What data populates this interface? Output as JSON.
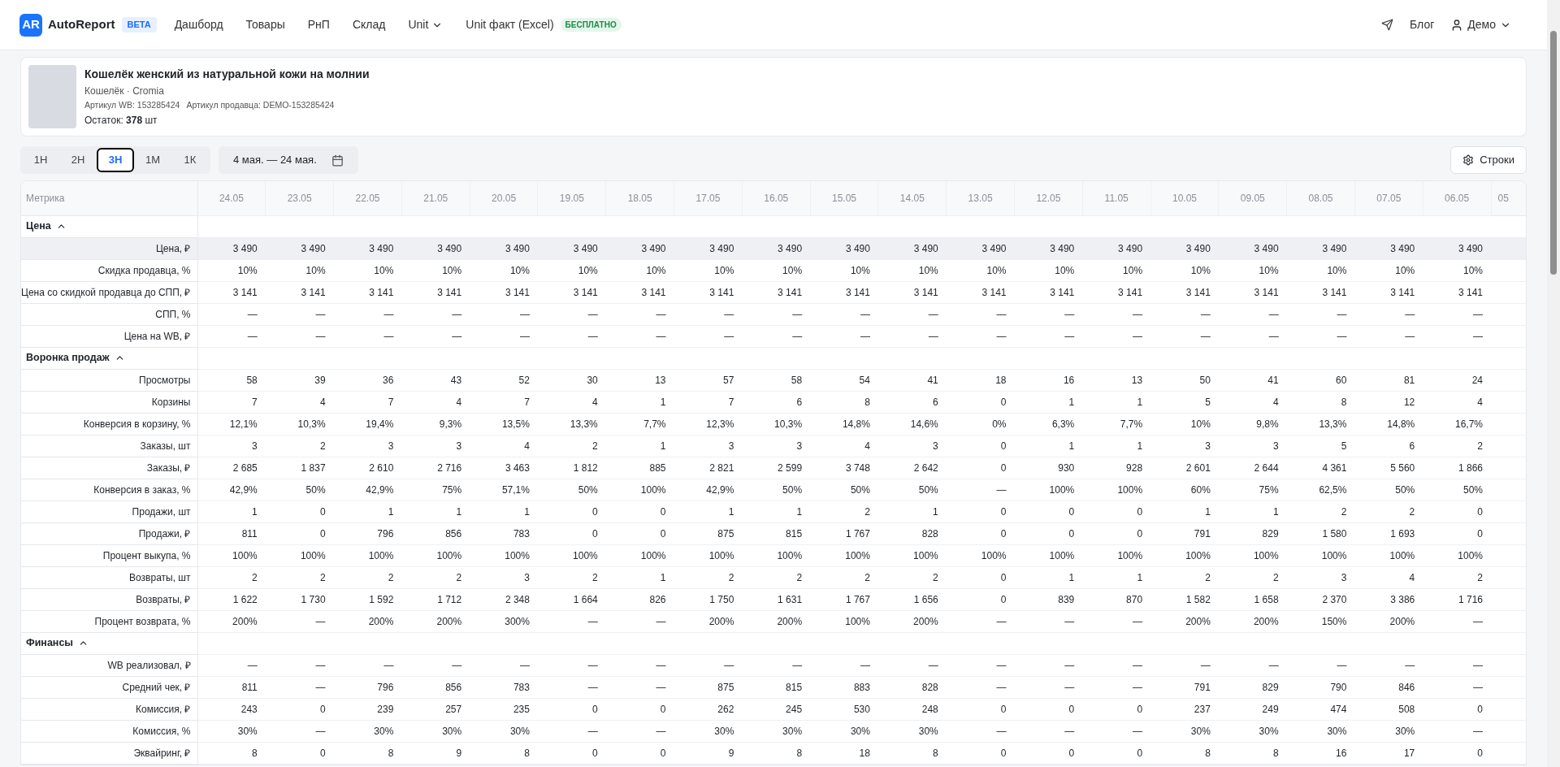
{
  "nav": {
    "logo_mark": "AR",
    "brand": "AutoReport",
    "brand_badge": "BETA",
    "items": [
      {
        "label": "Дашборд",
        "dropdown": false
      },
      {
        "label": "Товары",
        "dropdown": false
      },
      {
        "label": "РнП",
        "dropdown": false
      },
      {
        "label": "Склад",
        "dropdown": false
      },
      {
        "label": "Unit",
        "dropdown": true
      },
      {
        "label": "Unit факт (Excel)",
        "dropdown": false,
        "badge": "БЕСПЛАТНО"
      }
    ],
    "blog": "Блог",
    "user": "Демо"
  },
  "product": {
    "title": "Кошелёк женский из натуральной кожи на молнии",
    "subtitle": "Кошелёк · Cromia",
    "article_wb": "Артикул WB: 153285424",
    "article_seller": "Артикул продавца: DEMO-153285424",
    "stock": "Остаток: **378** шт"
  },
  "period_tabs": [
    {
      "label": "1Н",
      "selected": false
    },
    {
      "label": "2Н",
      "selected": false
    },
    {
      "label": "3Н",
      "selected": true
    },
    {
      "label": "1М",
      "selected": false
    },
    {
      "label": "1К",
      "selected": false
    }
  ],
  "date_range": "4 мая. — 24 мая.",
  "rows_button": "Строки",
  "table": {
    "columns": [
      "Метрика",
      "24.05",
      "23.05",
      "22.05",
      "21.05",
      "20.05",
      "19.05",
      "18.05",
      "17.05",
      "16.05",
      "15.05",
      "14.05",
      "13.05",
      "12.05",
      "11.05",
      "10.05",
      "09.05",
      "08.05",
      "07.05",
      "06.05",
      "05"
    ],
    "groups": [
      {
        "title": "Цена",
        "expanded": true,
        "rows": [
          {
            "label": "Цена, ₽",
            "highlighted": true,
            "values": [
              "3 490",
              "3 490",
              "3 490",
              "3 490",
              "3 490",
              "3 490",
              "3 490",
              "3 490",
              "3 490",
              "3 490",
              "3 490",
              "3 490",
              "3 490",
              "3 490",
              "3 490",
              "3 490",
              "3 490",
              "3 490",
              "3 490"
            ]
          },
          {
            "label": "Скидка продавца, %",
            "highlighted": false,
            "values": [
              "10%",
              "10%",
              "10%",
              "10%",
              "10%",
              "10%",
              "10%",
              "10%",
              "10%",
              "10%",
              "10%",
              "10%",
              "10%",
              "10%",
              "10%",
              "10%",
              "10%",
              "10%",
              "10%"
            ]
          },
          {
            "label": "Цена со скидкой продавца до СПП, ₽",
            "highlighted": false,
            "values": [
              "3 141",
              "3 141",
              "3 141",
              "3 141",
              "3 141",
              "3 141",
              "3 141",
              "3 141",
              "3 141",
              "3 141",
              "3 141",
              "3 141",
              "3 141",
              "3 141",
              "3 141",
              "3 141",
              "3 141",
              "3 141",
              "3 141"
            ]
          },
          {
            "label": "СПП, %",
            "highlighted": false,
            "values": [
              "—",
              "—",
              "—",
              "—",
              "—",
              "—",
              "—",
              "—",
              "—",
              "—",
              "—",
              "—",
              "—",
              "—",
              "—",
              "—",
              "—",
              "—",
              "—"
            ]
          },
          {
            "label": "Цена на WB, ₽",
            "highlighted": false,
            "values": [
              "—",
              "—",
              "—",
              "—",
              "—",
              "—",
              "—",
              "—",
              "—",
              "—",
              "—",
              "—",
              "—",
              "—",
              "—",
              "—",
              "—",
              "—",
              "—"
            ]
          }
        ]
      },
      {
        "title": "Воронка продаж",
        "expanded": true,
        "rows": [
          {
            "label": "Просмотры",
            "highlighted": false,
            "values": [
              "58",
              "39",
              "36",
              "43",
              "52",
              "30",
              "13",
              "57",
              "58",
              "54",
              "41",
              "18",
              "16",
              "13",
              "50",
              "41",
              "60",
              "81",
              "24"
            ]
          },
          {
            "label": "Корзины",
            "highlighted": false,
            "values": [
              "7",
              "4",
              "7",
              "4",
              "7",
              "4",
              "1",
              "7",
              "6",
              "8",
              "6",
              "0",
              "1",
              "1",
              "5",
              "4",
              "8",
              "12",
              "4"
            ]
          },
          {
            "label": "Конверсия в корзину, %",
            "highlighted": false,
            "values": [
              "12,1%",
              "10,3%",
              "19,4%",
              "9,3%",
              "13,5%",
              "13,3%",
              "7,7%",
              "12,3%",
              "10,3%",
              "14,8%",
              "14,6%",
              "0%",
              "6,3%",
              "7,7%",
              "10%",
              "9,8%",
              "13,3%",
              "14,8%",
              "16,7%"
            ]
          },
          {
            "label": "Заказы, шт",
            "highlighted": false,
            "values": [
              "3",
              "2",
              "3",
              "3",
              "4",
              "2",
              "1",
              "3",
              "3",
              "4",
              "3",
              "0",
              "1",
              "1",
              "3",
              "3",
              "5",
              "6",
              "2"
            ]
          },
          {
            "label": "Заказы, ₽",
            "highlighted": false,
            "values": [
              "2 685",
              "1 837",
              "2 610",
              "2 716",
              "3 463",
              "1 812",
              "885",
              "2 821",
              "2 599",
              "3 748",
              "2 642",
              "0",
              "930",
              "928",
              "2 601",
              "2 644",
              "4 361",
              "5 560",
              "1 866"
            ]
          },
          {
            "label": "Конверсия в заказ, %",
            "highlighted": false,
            "values": [
              "42,9%",
              "50%",
              "42,9%",
              "75%",
              "57,1%",
              "50%",
              "100%",
              "42,9%",
              "50%",
              "50%",
              "50%",
              "—",
              "100%",
              "100%",
              "60%",
              "75%",
              "62,5%",
              "50%",
              "50%"
            ]
          },
          {
            "label": "Продажи, шт",
            "highlighted": false,
            "values": [
              "1",
              "0",
              "1",
              "1",
              "1",
              "0",
              "0",
              "1",
              "1",
              "2",
              "1",
              "0",
              "0",
              "0",
              "1",
              "1",
              "2",
              "2",
              "0"
            ]
          },
          {
            "label": "Продажи, ₽",
            "highlighted": false,
            "values": [
              "811",
              "0",
              "796",
              "856",
              "783",
              "0",
              "0",
              "875",
              "815",
              "1 767",
              "828",
              "0",
              "0",
              "0",
              "791",
              "829",
              "1 580",
              "1 693",
              "0"
            ]
          },
          {
            "label": "Процент выкупа, %",
            "highlighted": false,
            "values": [
              "100%",
              "100%",
              "100%",
              "100%",
              "100%",
              "100%",
              "100%",
              "100%",
              "100%",
              "100%",
              "100%",
              "100%",
              "100%",
              "100%",
              "100%",
              "100%",
              "100%",
              "100%",
              "100%"
            ]
          },
          {
            "label": "Возвраты, шт",
            "highlighted": false,
            "values": [
              "2",
              "2",
              "2",
              "2",
              "3",
              "2",
              "1",
              "2",
              "2",
              "2",
              "2",
              "0",
              "1",
              "1",
              "2",
              "2",
              "3",
              "4",
              "2"
            ]
          },
          {
            "label": "Возвраты, ₽",
            "highlighted": false,
            "values": [
              "1 622",
              "1 730",
              "1 592",
              "1 712",
              "2 348",
              "1 664",
              "826",
              "1 750",
              "1 631",
              "1 767",
              "1 656",
              "0",
              "839",
              "870",
              "1 582",
              "1 658",
              "2 370",
              "3 386",
              "1 716"
            ]
          },
          {
            "label": "Процент возврата, %",
            "highlighted": false,
            "values": [
              "200%",
              "—",
              "200%",
              "200%",
              "300%",
              "—",
              "—",
              "200%",
              "200%",
              "100%",
              "200%",
              "—",
              "—",
              "—",
              "200%",
              "200%",
              "150%",
              "200%",
              "—"
            ]
          }
        ]
      },
      {
        "title": "Финансы",
        "expanded": true,
        "rows": [
          {
            "label": "WB реализовал, ₽",
            "highlighted": false,
            "values": [
              "—",
              "—",
              "—",
              "—",
              "—",
              "—",
              "—",
              "—",
              "—",
              "—",
              "—",
              "—",
              "—",
              "—",
              "—",
              "—",
              "—",
              "—",
              "—"
            ]
          },
          {
            "label": "Средний чек, ₽",
            "highlighted": false,
            "values": [
              "811",
              "—",
              "796",
              "856",
              "783",
              "—",
              "—",
              "875",
              "815",
              "883",
              "828",
              "—",
              "—",
              "—",
              "791",
              "829",
              "790",
              "846",
              "—"
            ]
          },
          {
            "label": "Комиссия, ₽",
            "highlighted": false,
            "values": [
              "243",
              "0",
              "239",
              "257",
              "235",
              "0",
              "0",
              "262",
              "245",
              "530",
              "248",
              "0",
              "0",
              "0",
              "237",
              "249",
              "474",
              "508",
              "0"
            ]
          },
          {
            "label": "Комиссия, %",
            "highlighted": false,
            "values": [
              "30%",
              "—",
              "30%",
              "30%",
              "30%",
              "—",
              "—",
              "30%",
              "30%",
              "30%",
              "30%",
              "—",
              "—",
              "—",
              "30%",
              "30%",
              "30%",
              "30%",
              "—"
            ]
          },
          {
            "label": "Эквайринг, ₽",
            "highlighted": false,
            "values": [
              "8",
              "0",
              "8",
              "9",
              "8",
              "0",
              "0",
              "9",
              "8",
              "18",
              "8",
              "0",
              "0",
              "0",
              "8",
              "8",
              "16",
              "17",
              "0"
            ]
          }
        ]
      }
    ]
  }
}
